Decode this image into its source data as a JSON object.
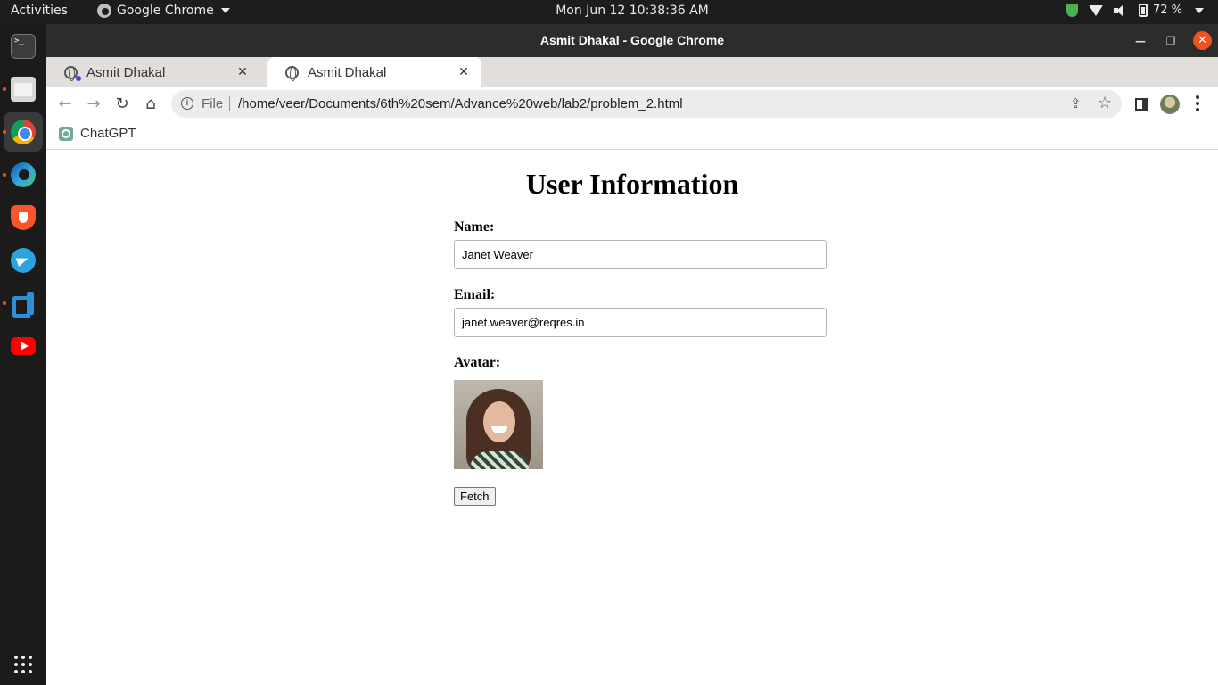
{
  "system": {
    "activities_label": "Activities",
    "app_menu_label": "Google Chrome",
    "clock": "Mon Jun 12  10:38:36 AM",
    "battery_percent": "72 %"
  },
  "dock": {
    "terminal_glyph": ">_"
  },
  "window": {
    "title": "Asmit Dhakal - Google Chrome",
    "minimize_glyph": "—",
    "maximize_glyph": "❐",
    "close_glyph": "✕"
  },
  "tabs": [
    {
      "title": "Asmit Dhakal",
      "close_glyph": "✕"
    },
    {
      "title": "Asmit Dhakal",
      "close_glyph": "✕"
    }
  ],
  "new_tab_glyph": "+",
  "toolbar": {
    "back_glyph": "←",
    "forward_glyph": "→",
    "reload_glyph": "↻",
    "home_glyph": "⌂",
    "info_glyph": "i",
    "scheme_label": "File",
    "url": "/home/veer/Documents/6th%20sem/Advance%20web/lab2/problem_2.html",
    "share_glyph": "⇪",
    "star_glyph": "☆"
  },
  "bookmarks": [
    {
      "label": "ChatGPT"
    }
  ],
  "page": {
    "heading": "User Information",
    "name_label": "Name:",
    "name_value": "Janet Weaver",
    "email_label": "Email:",
    "email_value": "janet.weaver@reqres.in",
    "avatar_label": "Avatar:",
    "fetch_label": "Fetch"
  }
}
